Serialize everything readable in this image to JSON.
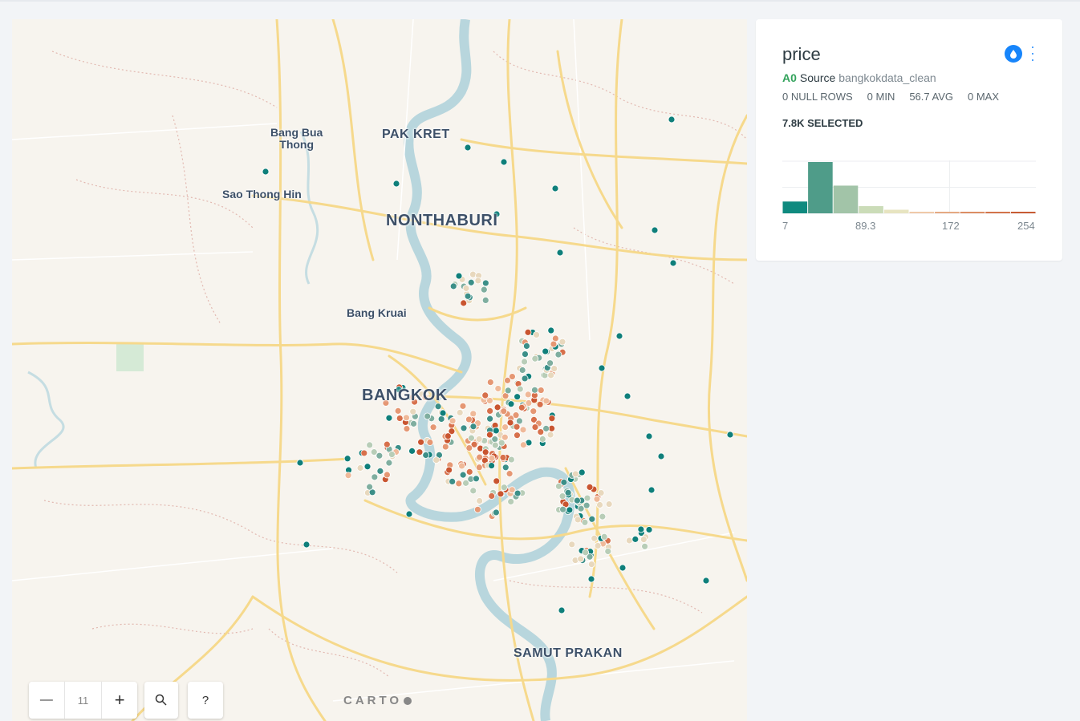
{
  "map": {
    "place_labels": [
      {
        "id": "bang-bua-thong",
        "text": "Bang Bua\nThong",
        "size": "small"
      },
      {
        "id": "pak-kret",
        "text": "PAK KRET",
        "size": "med"
      },
      {
        "id": "sao-thong-hin",
        "text": "Sao Thong Hin",
        "size": "small"
      },
      {
        "id": "nonthaburi",
        "text": "NONTHABURI",
        "size": "big"
      },
      {
        "id": "bang-kruai",
        "text": "Bang Kruai",
        "size": "small"
      },
      {
        "id": "bangkok",
        "text": "BANGKOK",
        "size": "big"
      },
      {
        "id": "samut-prakan",
        "text": "SAMUT PRAKAN",
        "size": "med"
      }
    ],
    "attribution": "CARTO",
    "zoom_level": "11",
    "zoom_out_label": "—",
    "zoom_in_label": "+",
    "search_icon": "search-icon",
    "help_label": "?"
  },
  "widget": {
    "title": "price",
    "node_id": "A0",
    "source_label": "Source",
    "source_name": "bangkokdata_clean",
    "stats": {
      "null_rows": "0 NULL ROWS",
      "min": "0 MIN",
      "avg": "56.7 AVG",
      "max": "0 MAX"
    },
    "selected": "7.8K SELECTED",
    "icons": [
      "droplet-icon",
      "more-vertical-icon"
    ]
  },
  "chart_data": {
    "type": "bar",
    "title": "price",
    "x_tick_labels": [
      "7",
      "89.3",
      "172",
      "254"
    ],
    "bins": [
      {
        "value": 0.23,
        "color": "#0f8a7f"
      },
      {
        "value": 1.0,
        "color": "#4f9c89"
      },
      {
        "value": 0.54,
        "color": "#a2c4a8"
      },
      {
        "value": 0.14,
        "color": "#cbdcb8"
      },
      {
        "value": 0.07,
        "color": "#e7e4c0"
      },
      {
        "value": 0.03,
        "color": "#efc9a8"
      },
      {
        "value": 0.03,
        "color": "#e5a982"
      },
      {
        "value": 0.03,
        "color": "#dc8e64"
      },
      {
        "value": 0.03,
        "color": "#d3744a"
      },
      {
        "value": 0.03,
        "color": "#c75c34"
      }
    ],
    "grid": true
  },
  "price_points_palette": [
    "#0f7f7a",
    "#3c8f88",
    "#7fae9f",
    "#b8cdb7",
    "#e8d8bd",
    "#efb999",
    "#e59773",
    "#d7704b",
    "#c95530"
  ]
}
